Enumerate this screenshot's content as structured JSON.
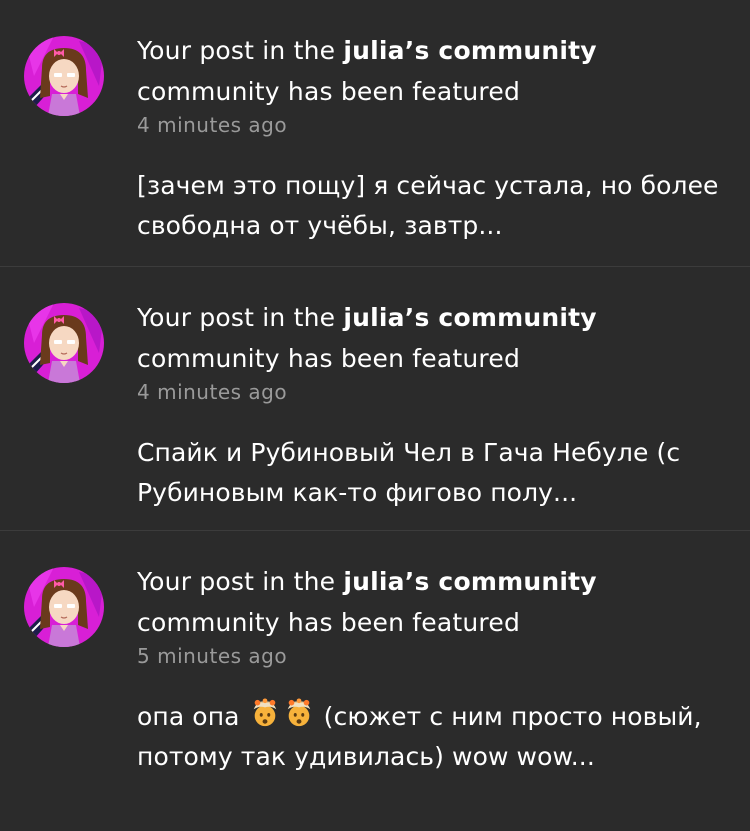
{
  "notifications": [
    {
      "prefix": "Your post in the ",
      "community": "julia’s community",
      "suffix": "community has been featured",
      "time": "4 minutes ago",
      "excerpt": "[зачем это пощу] я сейчас устала, но более свободна от учёбы, завтр..."
    },
    {
      "prefix": "Your post in the ",
      "community": "julia’s community",
      "suffix": "community has been featured",
      "time": "4 minutes ago",
      "excerpt": "Спайк и Рубиновый Чел в Гача Небуле (с Рубиновым как-то фигово полу..."
    },
    {
      "prefix": "Your post in the ",
      "community": "julia’s community",
      "suffix": "community has been featured",
      "time": "5 minutes ago",
      "excerpt_before": "опа опа",
      "emoji": "exploding-head-emoji",
      "excerpt_after": " (сюжет с ним просто новый, потому так удивилась) wow wow..."
    }
  ],
  "colors": {
    "background": "#2b2b2b",
    "divider": "#3c3c3c",
    "text": "#ffffff",
    "muted": "#9a9a9a",
    "avatar_bg": "#e020d0"
  }
}
